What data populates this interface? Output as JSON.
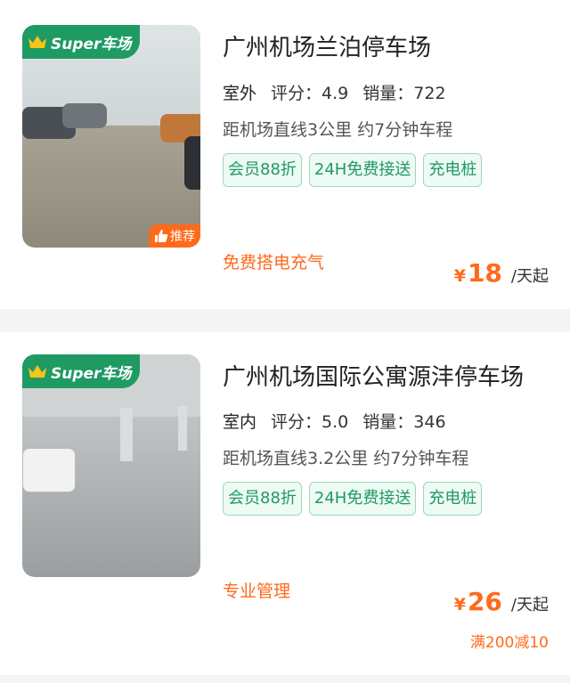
{
  "listings": [
    {
      "badge": "Super车场",
      "recommend": "推荐",
      "name": "广州机场兰泊停车场",
      "environment": "室外",
      "rating_label": "评分：",
      "rating": "4.9",
      "sales_label": "销量：",
      "sales": "722",
      "distance": "距机场直线3公里 约7分钟车程",
      "tags": [
        "会员88折",
        "24H免费接送",
        "充电桩"
      ],
      "note": "免费搭电充气",
      "currency": "¥",
      "price": "18",
      "unit": "/天起",
      "promo": ""
    },
    {
      "badge": "Super车场",
      "recommend": "",
      "name": "广州机场国际公寓源沣停车场",
      "environment": "室内",
      "rating_label": "评分：",
      "rating": "5.0",
      "sales_label": "销量：",
      "sales": "346",
      "distance": "距机场直线3.2公里 约7分钟车程",
      "tags": [
        "会员88折",
        "24H免费接送",
        "充电桩"
      ],
      "note": "专业管理",
      "currency": "¥",
      "price": "26",
      "unit": "/天起",
      "promo": "满200减10"
    }
  ],
  "colors": {
    "brand_green": "#1f9a63",
    "accent_orange": "#ff6a1a"
  }
}
